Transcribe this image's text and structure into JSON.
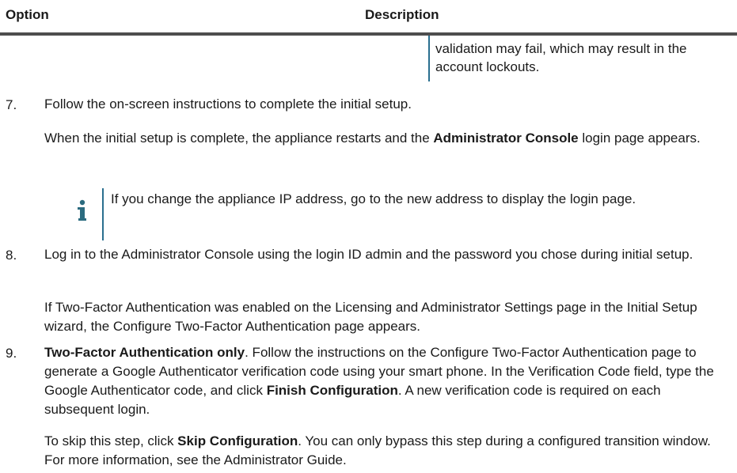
{
  "table": {
    "header_option": "Option",
    "header_description": "Description",
    "row_description": "validation may fail, which may result in the account lockouts."
  },
  "steps": [
    {
      "number": "7.",
      "text": "Follow the on-screen instructions to complete the initial setup.",
      "sub_pre": "When the initial setup is complete, the appliance restarts and the ",
      "sub_bold": "Administrator Console",
      "sub_post": " login page appears."
    },
    {
      "number": "8.",
      "text": "Log in to the Administrator Console using the login ID admin and the password you chose during initial setup.",
      "sub": "If Two-Factor Authentication was enabled on the Licensing and Administrator Settings page in the Initial Setup wizard, the Configure Two-Factor Authentication page appears."
    },
    {
      "number": "9.",
      "bold_lead": "Two-Factor Authentication only",
      "text_pre": ". Follow the instructions on the Configure Two-Factor Authentication page to generate a Google Authenticator verification code using your smart phone. In the Verification Code field, type the Google Authenticator code, and click ",
      "bold_action": "Finish Configuration",
      "text_post": ". A new verification code is required on each subsequent login.",
      "sub_pre": "To skip this step, click ",
      "sub_bold": "Skip Configuration",
      "sub_post": ". You can only bypass this step during a configured transition window. For more information, see the Administrator Guide."
    }
  ],
  "note": {
    "icon": "info-icon",
    "text": "If you change the appliance IP address, go to the new address to display the login page."
  },
  "colors": {
    "accent_rule": "#2a6f8f",
    "table_rule": "#4d4d4d",
    "note_icon": "#2b6b7f"
  }
}
